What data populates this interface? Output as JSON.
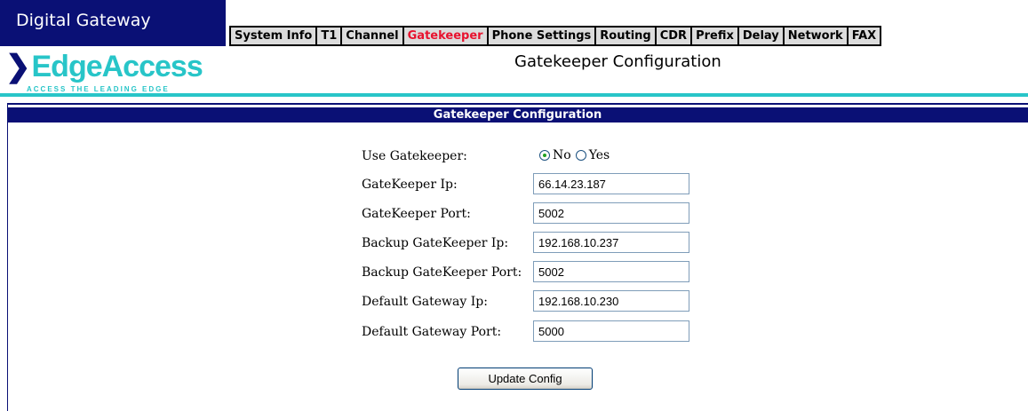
{
  "app": {
    "title": "Digital Gateway"
  },
  "logo": {
    "text": "EdgeAccess",
    "tagline": "ACCESS THE LEADING EDGE"
  },
  "nav": {
    "items": [
      {
        "label": "System Info"
      },
      {
        "label": "T1"
      },
      {
        "label": "Channel"
      },
      {
        "label": "Gatekeeper",
        "active": true
      },
      {
        "label": "Phone Settings"
      },
      {
        "label": "Routing"
      },
      {
        "label": "CDR"
      },
      {
        "label": "Prefix"
      },
      {
        "label": "Delay"
      },
      {
        "label": "Network"
      },
      {
        "label": "FAX"
      }
    ]
  },
  "page": {
    "heading": "Gatekeeper Configuration"
  },
  "panel": {
    "header": "Gatekeeper Configuration"
  },
  "form": {
    "use_gatekeeper": {
      "label": "Use Gatekeeper:",
      "options": [
        "No",
        "Yes"
      ],
      "selected": "No"
    },
    "gatekeeper_ip": {
      "label": "GateKeeper Ip:",
      "value": "66.14.23.187"
    },
    "gatekeeper_port": {
      "label": "GateKeeper Port:",
      "value": "5002"
    },
    "backup_gatekeeper_ip": {
      "label": "Backup GateKeeper Ip:",
      "value": "192.168.10.237"
    },
    "backup_gatekeeper_port": {
      "label": "Backup GateKeeper Port:",
      "value": "5002"
    },
    "default_gateway_ip": {
      "label": "Default Gateway Ip:",
      "value": "192.168.10.230"
    },
    "default_gateway_port": {
      "label": "Default Gateway Port:",
      "value": "5000"
    },
    "update_button": "Update Config"
  },
  "colors": {
    "navy": "#0a1075",
    "teal": "#28c5c8",
    "active_tab": "#e8122e"
  }
}
